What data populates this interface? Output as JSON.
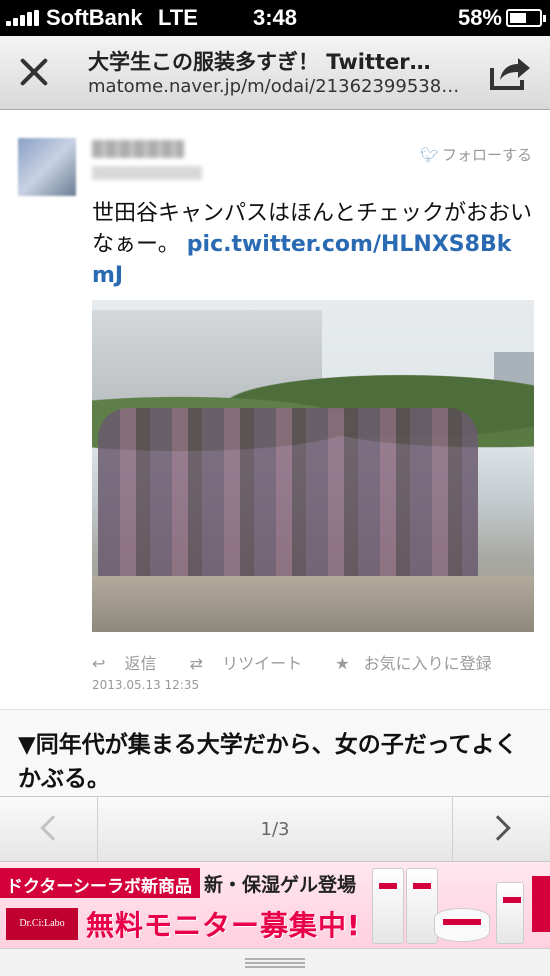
{
  "status_bar": {
    "carrier": "SoftBank",
    "network": "LTE",
    "time": "3:48",
    "battery_pct": "58%",
    "battery_level": 0.58
  },
  "browser": {
    "title": "大学生この服装多すぎ！ Twitter…",
    "url": "matome.naver.jp/m/odai/21362399538…",
    "close_icon": "close-icon",
    "share_icon": "share-icon"
  },
  "tweet": {
    "follow_label": "フォローする",
    "text": "世田谷キャンパスはほんとチェックがおおいなぁー。",
    "link": "pic.twitter.com/HLNXS8BkmJ",
    "actions": {
      "reply": "返信",
      "retweet": "リツイート",
      "favorite": "お気に入りに登録"
    },
    "timestamp": "2013.05.13 12:35"
  },
  "section_heading": "▼同年代が集まる大学だから、女の子だってよくかぶる。",
  "pager": {
    "current": "1/3"
  },
  "ad": {
    "badge": "ドクターシーラボ新商品",
    "headline": "新・保湿ゲル登場",
    "cta": "無料モニター募集中!",
    "logo": "Dr.Ci:Labo"
  }
}
